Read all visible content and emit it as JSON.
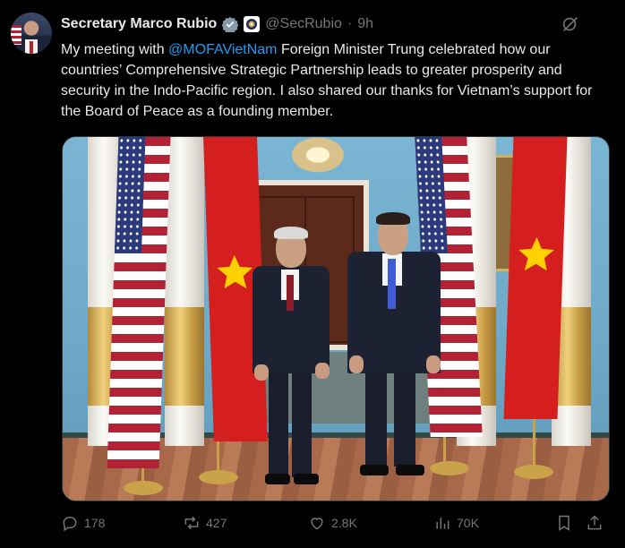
{
  "author": {
    "name": "Secretary Marco Rubio",
    "handle": "@SecRubio",
    "separator": "·",
    "time": "9h"
  },
  "tweet": {
    "text_prefix": "My meeting with ",
    "mention": "@MOFAVietNam",
    "text_suffix": " Foreign Minister Trung celebrated how our countries’ Comprehensive Strategic Partnership leads to greater prosperity and security in the Indo-Pacific region. I also shared our thanks for Vietnam’s support for the Board of Peace as a founding member."
  },
  "media": {
    "kind": "photo"
  },
  "actions": {
    "replies": "178",
    "reposts": "427",
    "likes": "2.8K",
    "views": "70K"
  },
  "colors": {
    "background": "#000000",
    "text": "#e7e9ea",
    "muted": "#71767b",
    "accent": "#1d9bf0",
    "verified": "#829aab"
  },
  "icons": [
    "verified-badge-icon",
    "state-seal-icon",
    "grok-icon",
    "reply-icon",
    "repost-icon",
    "like-icon",
    "views-icon",
    "bookmark-icon",
    "share-icon"
  ]
}
